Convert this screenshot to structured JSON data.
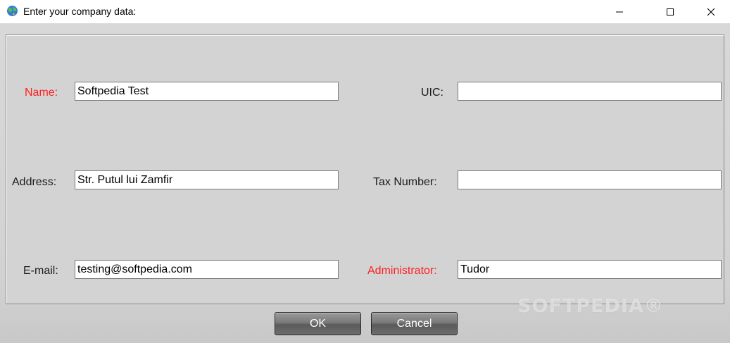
{
  "window": {
    "title": "Enter your company data:",
    "app_icon": "globe-icon",
    "controls": {
      "minimize": "minimize-icon",
      "maximize": "maximize-icon",
      "close": "close-icon"
    }
  },
  "form": {
    "name": {
      "label": "Name:",
      "value": "Softpedia Test",
      "required": true
    },
    "address": {
      "label": "Address:",
      "value": "Str. Putul lui Zamfir",
      "required": false
    },
    "email": {
      "label": "E-mail:",
      "value": "testing@softpedia.com",
      "required": false
    },
    "uic": {
      "label": "UIC:",
      "value": "",
      "required": false
    },
    "tax_number": {
      "label": "Tax Number:",
      "value": "",
      "required": false
    },
    "administrator": {
      "label": "Administrator:",
      "value": "Tudor",
      "required": true
    }
  },
  "buttons": {
    "ok_label": "OK",
    "cancel_label": "Cancel"
  },
  "watermark": {
    "text": "SOFTPEDIA®"
  },
  "colors": {
    "required_label": "#ff2020",
    "panel_background": "#d3d3d3",
    "button_gradient": "#6e6e6e"
  }
}
